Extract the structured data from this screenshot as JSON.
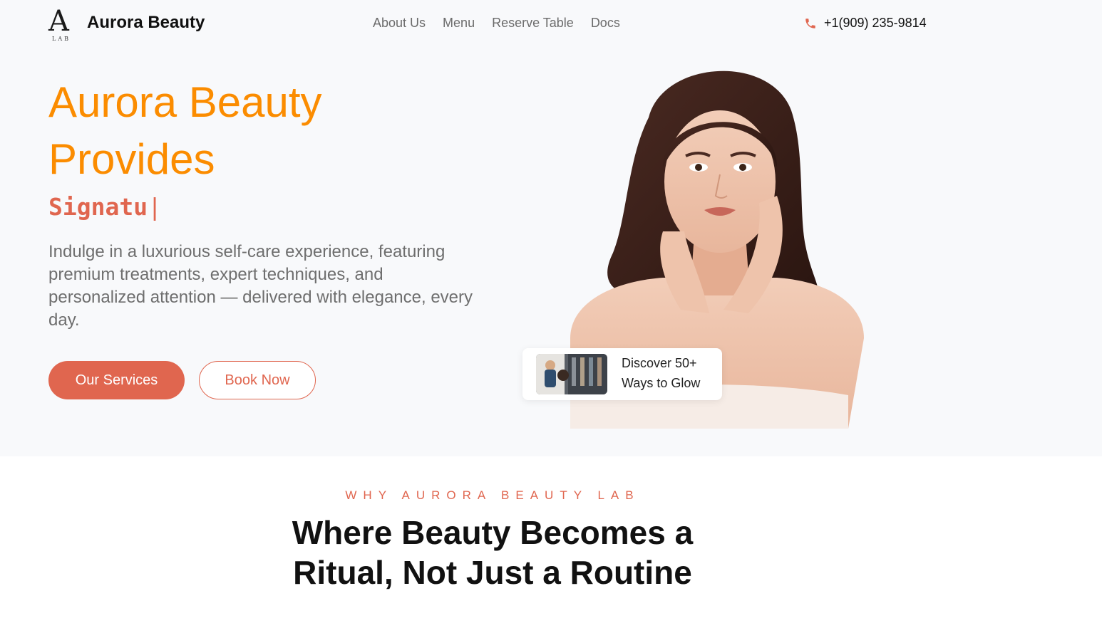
{
  "header": {
    "logo": {
      "letter": "A",
      "sub": "LAB"
    },
    "brand": "Aurora Beauty",
    "nav": [
      {
        "label": "About Us"
      },
      {
        "label": "Menu"
      },
      {
        "label": "Reserve Table"
      },
      {
        "label": "Docs"
      }
    ],
    "phone": {
      "icon": "phone-icon",
      "number": "+1(909) 235-9814"
    }
  },
  "hero": {
    "title_line1": "Aurora Beauty",
    "title_line2": "Provides",
    "typed_text": "Signatu",
    "caret": "|",
    "description": " Indulge in a luxurious self-care experience, featuring premium treatments, expert techniques, and personalized attention — delivered with elegance, every day.",
    "primary_button": "Our Services",
    "secondary_button": "Book Now",
    "discover_card": {
      "line1": "Discover 50+",
      "line2": "Ways to Glow"
    }
  },
  "why": {
    "eyebrow": "WHY AURORA BEAUTY LAB",
    "title_line1": "Where Beauty Becomes a",
    "title_line2": "Ritual, Not Just a Routine"
  },
  "colors": {
    "accent": "#e0664f",
    "title_orange": "#fb8c00",
    "hero_bg": "#f8f9fb",
    "text_dark": "#111111",
    "text_muted": "#6e6e6e"
  }
}
